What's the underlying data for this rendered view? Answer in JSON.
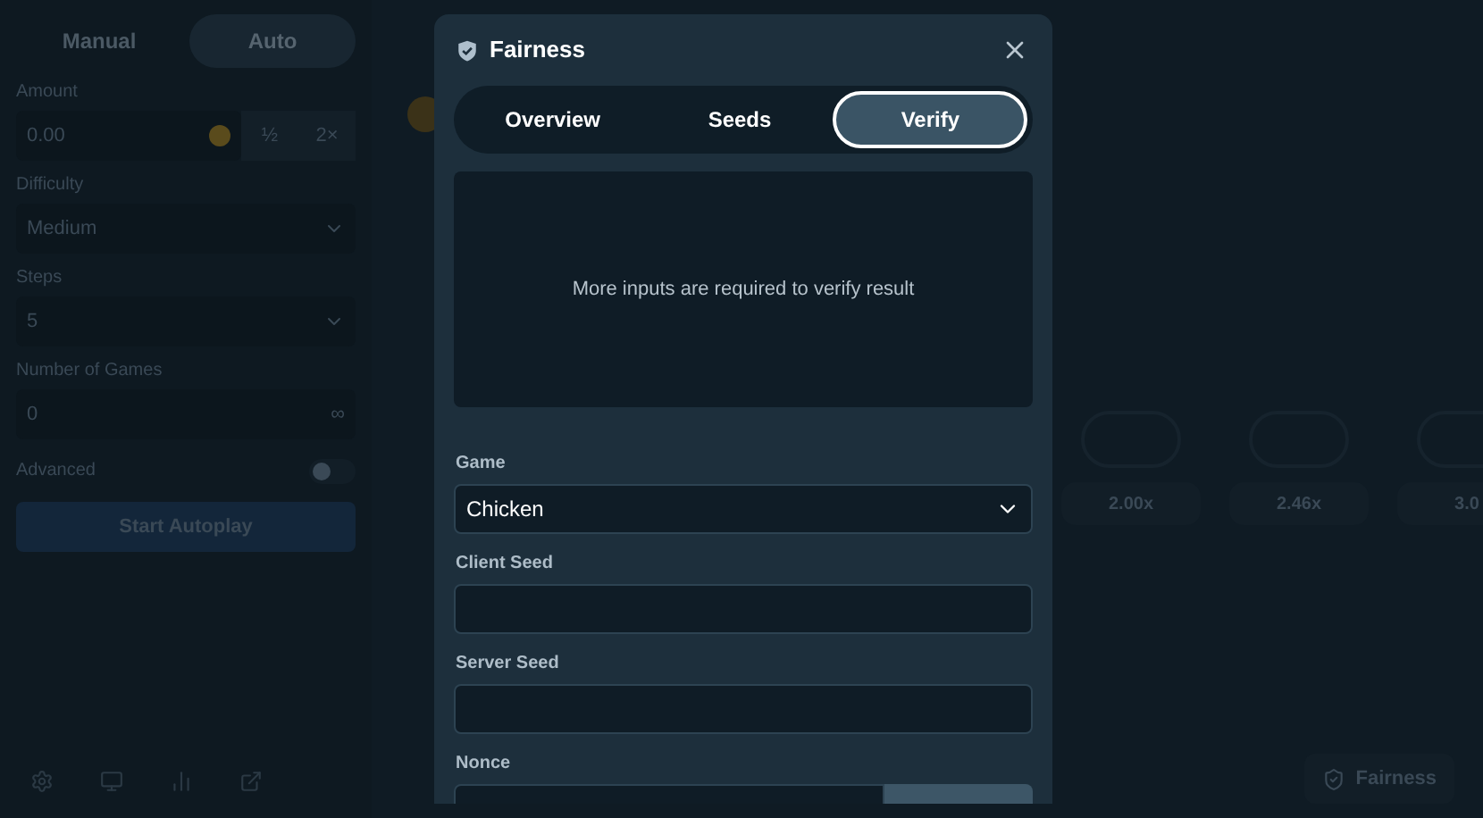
{
  "sidebar": {
    "tabs": [
      {
        "label": "Manual",
        "selected": false
      },
      {
        "label": "Auto",
        "selected": true
      }
    ],
    "fields": [
      {
        "kind": "amount",
        "label": "Amount",
        "value": "0.00",
        "buttons": [
          "½",
          "2×"
        ]
      },
      {
        "kind": "select",
        "label": "Difficulty",
        "value": "Medium"
      },
      {
        "kind": "select",
        "label": "Steps",
        "value": "5"
      },
      {
        "kind": "number",
        "label": "Number of Games",
        "value": "0",
        "suffix": "∞"
      }
    ],
    "advanced": {
      "label": "Advanced",
      "on": false
    },
    "start_button": "Start Autoplay"
  },
  "game": {
    "multipliers": [
      "2.00x",
      "2.46x",
      "3.0"
    ]
  },
  "fairness_button": "Fairness",
  "modal": {
    "title": "Fairness",
    "tabs": [
      {
        "label": "Overview",
        "selected": false
      },
      {
        "label": "Seeds",
        "selected": false
      },
      {
        "label": "Verify",
        "selected": true
      }
    ],
    "result_message": "More inputs are required to verify result",
    "fields": [
      {
        "kind": "select",
        "label": "Game",
        "value": "Chicken"
      },
      {
        "kind": "input",
        "label": "Client Seed"
      },
      {
        "kind": "input",
        "label": "Server Seed"
      },
      {
        "kind": "nonce",
        "label": "Nonce"
      }
    ]
  }
}
